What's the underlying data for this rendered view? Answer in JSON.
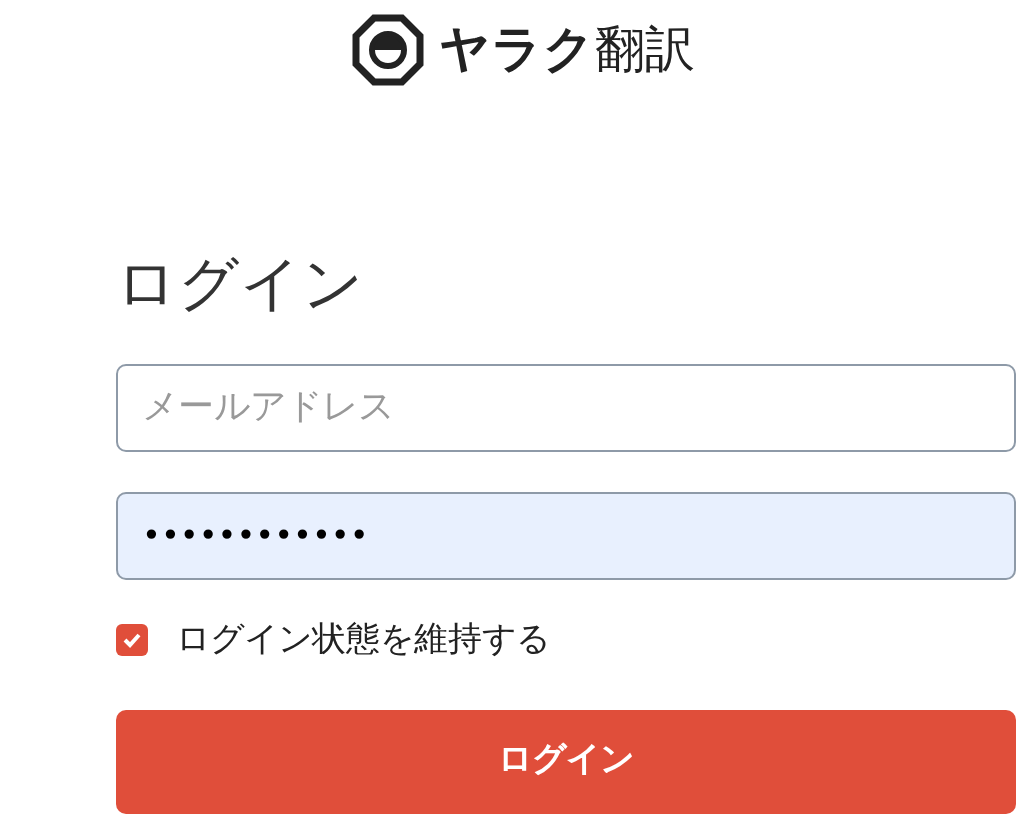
{
  "logo": {
    "brand": "ヤラク",
    "suffix": "翻訳"
  },
  "heading": "ログイン",
  "email": {
    "placeholder": "メールアドレス"
  },
  "password": {
    "value": "••••••••••••"
  },
  "remember": {
    "label": "ログイン状態を維持する",
    "checked": true
  },
  "submit": {
    "label": "ログイン"
  }
}
